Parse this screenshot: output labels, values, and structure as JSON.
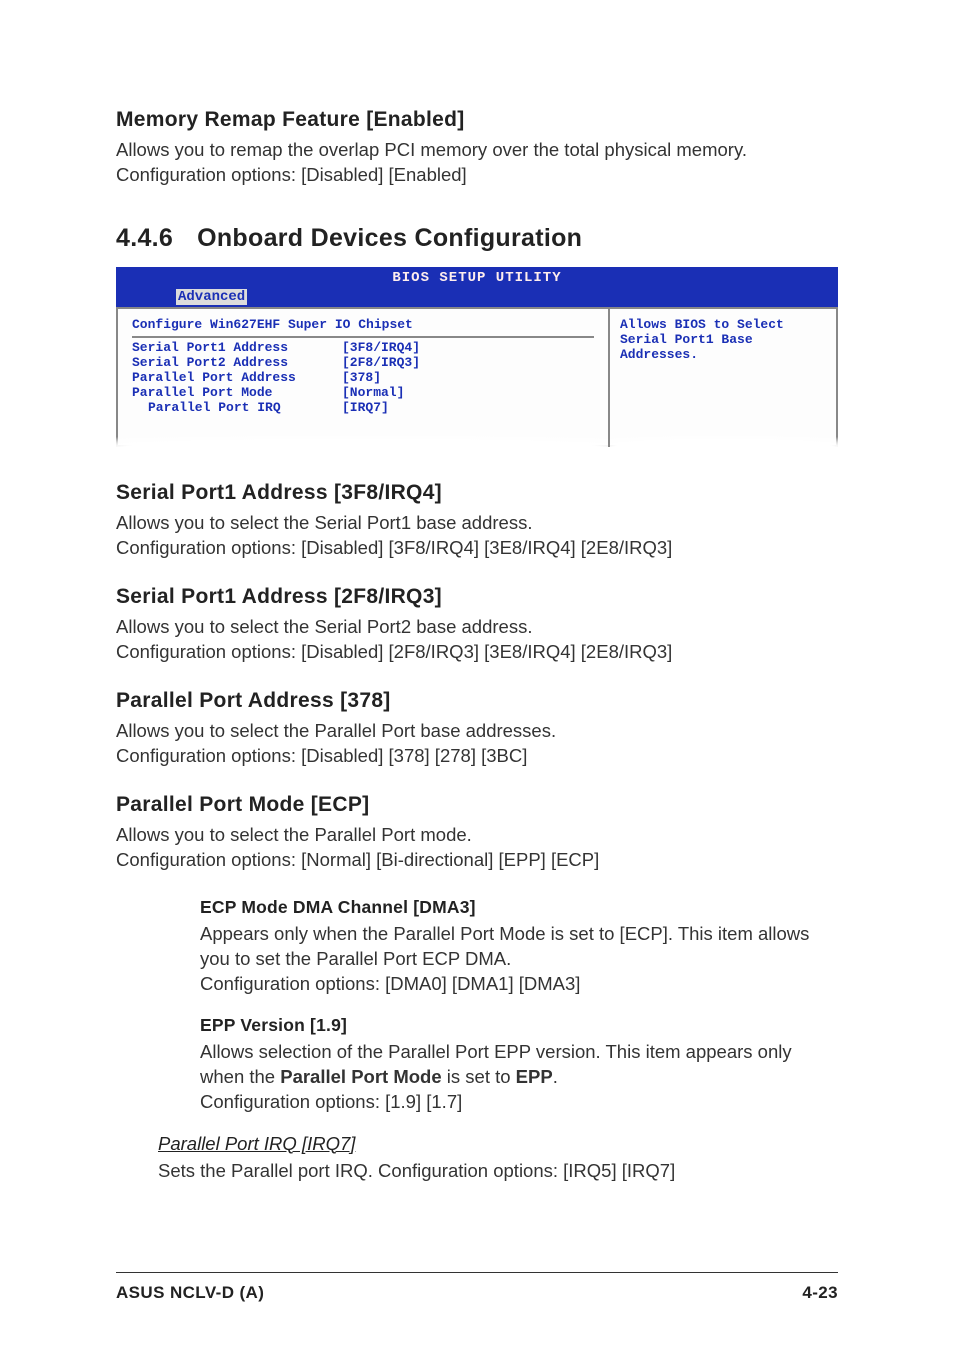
{
  "mem_remap": {
    "heading": "Memory Remap Feature [Enabled]",
    "body": "Allows you to remap the overlap PCI memory over the total physical memory. Configuration options: [Disabled] [Enabled]"
  },
  "section446": {
    "num": "4.4.6",
    "title": "Onboard Devices Configuration"
  },
  "bios": {
    "header_title": "BIOS SETUP UTILITY",
    "tab": "Advanced",
    "left_title": "Configure Win627EHF Super IO Chipset",
    "rows": [
      {
        "label": "Serial Port1 Address",
        "value": "[3F8/IRQ4]",
        "indent": false
      },
      {
        "label": "Serial Port2 Address",
        "value": "[2F8/IRQ3]",
        "indent": false
      },
      {
        "label": "Parallel Port Address",
        "value": "[378]",
        "indent": false
      },
      {
        "label": "Parallel Port Mode",
        "value": "[Normal]",
        "indent": false
      },
      {
        "label": "Parallel Port IRQ",
        "value": "[IRQ7]",
        "indent": true
      }
    ],
    "help": "Allows BIOS to Select Serial Port1 Base Addresses."
  },
  "sp1a": {
    "heading": "Serial Port1 Address [3F8/IRQ4]",
    "l1": "Allows you to select the Serial Port1 base address.",
    "l2": "Configuration options: [Disabled] [3F8/IRQ4] [3E8/IRQ4] [2E8/IRQ3]"
  },
  "sp1b": {
    "heading": "Serial Port1 Address [2F8/IRQ3]",
    "l1": "Allows you to select the Serial Port2 base address.",
    "l2": "Configuration options: [Disabled] [2F8/IRQ3] [3E8/IRQ4] [2E8/IRQ3]"
  },
  "ppa": {
    "heading": "Parallel Port Address [378]",
    "l1": "Allows you to select the Parallel Port base addresses.",
    "l2": "Configuration options: [Disabled] [378] [278] [3BC]"
  },
  "ppm": {
    "heading": "Parallel Port Mode [ECP]",
    "l1": "Allows you to select the Parallel Port  mode.",
    "l2": "Configuration options: [Normal] [Bi-directional] [EPP] [ECP]"
  },
  "ecp": {
    "heading": "ECP Mode DMA Channel [DMA3]",
    "l1": "Appears only when the Parallel Port Mode is set to [ECP]. This item allows you to set the Parallel Port ECP DMA.",
    "l2": "Configuration options: [DMA0] [DMA1] [DMA3]"
  },
  "epp": {
    "heading": "EPP Version [1.9]",
    "pre": "Allows selection of the Parallel Port EPP version. This item appears only when the ",
    "b1": "Parallel Port Mode",
    "mid": " is set to ",
    "b2": "EPP",
    "post": ".",
    "l2": "Configuration options: [1.9] [1.7]"
  },
  "ppirq": {
    "heading": "Parallel Port IRQ [IRQ7]",
    "body": "Sets the Parallel port IRQ. Configuration options: [IRQ5] [IRQ7]"
  },
  "footer": {
    "left": "ASUS NCLV-D (A)",
    "right": "4-23"
  }
}
